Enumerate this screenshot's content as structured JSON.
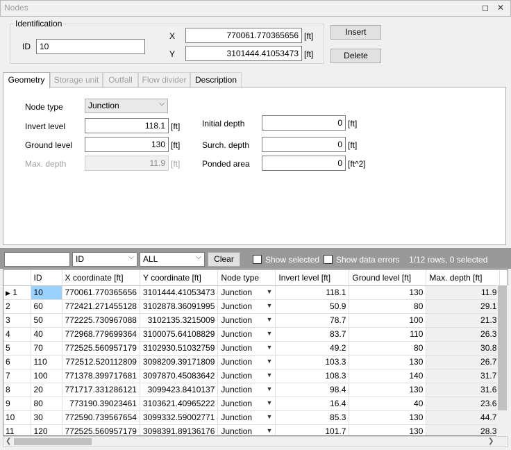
{
  "window": {
    "title": "Nodes",
    "restore_glyph": "◻",
    "close_glyph": "✕"
  },
  "identification": {
    "group_label": "Identification",
    "id_label": "ID",
    "id_value": "10",
    "x_label": "X",
    "x_value": "770061.770365656",
    "x_unit": "[ft]",
    "y_label": "Y",
    "y_value": "3101444.41053473",
    "y_unit": "[ft]"
  },
  "buttons": {
    "insert": "Insert",
    "delete": "Delete"
  },
  "tabs": [
    {
      "label": "Geometry",
      "active": true
    },
    {
      "label": "Storage unit",
      "active": false
    },
    {
      "label": "Outfall",
      "active": false
    },
    {
      "label": "Flow divider",
      "active": false
    },
    {
      "label": "Description",
      "active": false
    }
  ],
  "geometry": {
    "node_type_label": "Node type",
    "node_type_value": "Junction",
    "invert_label": "Invert level",
    "invert_value": "118.1",
    "invert_unit": "[ft]",
    "ground_label": "Ground level",
    "ground_value": "130",
    "ground_unit": "[ft]",
    "maxdepth_label": "Max. depth",
    "maxdepth_value": "11.9",
    "maxdepth_unit": "[ft]",
    "initial_label": "Initial depth",
    "initial_value": "0",
    "initial_unit": "[ft]",
    "surch_label": "Surch. depth",
    "surch_value": "0",
    "surch_unit": "[ft]",
    "ponded_label": "Ponded area",
    "ponded_value": "0",
    "ponded_unit": "[ft^2]"
  },
  "filter": {
    "search_value": "",
    "column_value": "ID",
    "scope_value": "ALL",
    "clear_label": "Clear",
    "show_selected_label": "Show selected",
    "show_errors_label": "Show data errors",
    "status": "1/12 rows, 0 selected"
  },
  "table": {
    "current_row_marker": "▶",
    "headers": [
      "ID",
      "X coordinate [ft]",
      "Y coordinate [ft]",
      "Node type",
      "Invert level [ft]",
      "Ground level [ft]",
      "Max. depth [ft]"
    ],
    "rows": [
      {
        "n": "1",
        "id": "10",
        "x": "770061.770365656",
        "y": "3101444.41053473",
        "type": "Junction",
        "invert": "118.1",
        "ground": "130",
        "max": "11.9"
      },
      {
        "n": "2",
        "id": "60",
        "x": "772421.271455128",
        "y": "3102878.36091995",
        "type": "Junction",
        "invert": "50.9",
        "ground": "80",
        "max": "29.1"
      },
      {
        "n": "3",
        "id": "50",
        "x": "772225.730967088",
        "y": "3102135.3215009",
        "type": "Junction",
        "invert": "78.7",
        "ground": "100",
        "max": "21.3"
      },
      {
        "n": "4",
        "id": "40",
        "x": "772968.779699364",
        "y": "3100075.64108829",
        "type": "Junction",
        "invert": "83.7",
        "ground": "110",
        "max": "26.3"
      },
      {
        "n": "5",
        "id": "70",
        "x": "772525.560957179",
        "y": "3102930.51032759",
        "type": "Junction",
        "invert": "49.2",
        "ground": "80",
        "max": "30.8"
      },
      {
        "n": "6",
        "id": "110",
        "x": "772512.520112809",
        "y": "3098209.39171809",
        "type": "Junction",
        "invert": "103.3",
        "ground": "130",
        "max": "26.7"
      },
      {
        "n": "7",
        "id": "100",
        "x": "771378.399717681",
        "y": "3097870.45083642",
        "type": "Junction",
        "invert": "108.3",
        "ground": "140",
        "max": "31.7"
      },
      {
        "n": "8",
        "id": "20",
        "x": "771717.331286121",
        "y": "3099423.8410137",
        "type": "Junction",
        "invert": "98.4",
        "ground": "130",
        "max": "31.6"
      },
      {
        "n": "9",
        "id": "80",
        "x": "773190.39023461",
        "y": "3103621.40965222",
        "type": "Junction",
        "invert": "16.4",
        "ground": "40",
        "max": "23.6"
      },
      {
        "n": "10",
        "id": "30",
        "x": "772590.739567654",
        "y": "3099332.59002771",
        "type": "Junction",
        "invert": "85.3",
        "ground": "130",
        "max": "44.7"
      },
      {
        "n": "11",
        "id": "120",
        "x": "772525.560957179",
        "y": "3098391.89136176",
        "type": "Junction",
        "invert": "101.7",
        "ground": "130",
        "max": "28.3"
      }
    ]
  }
}
